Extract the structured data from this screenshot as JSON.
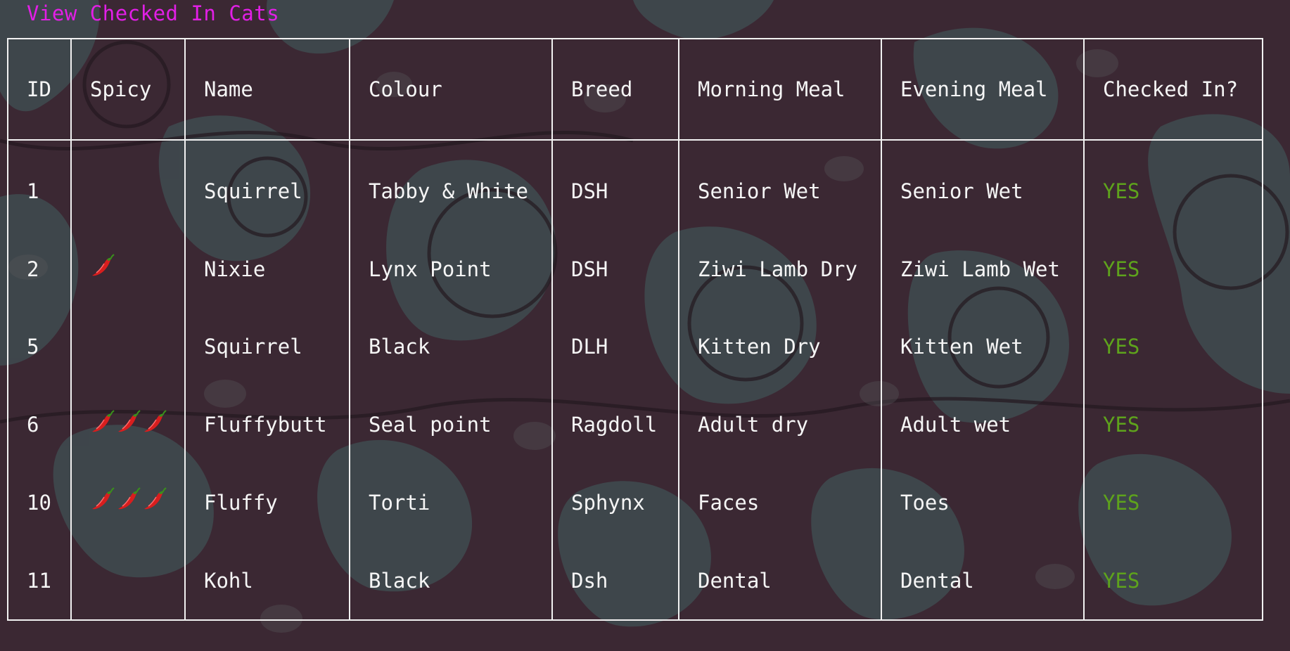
{
  "page": {
    "link_label": "View Checked In Cats"
  },
  "table": {
    "headers": [
      "ID",
      "Spicy",
      "Name",
      "Colour",
      "Breed",
      "Morning Meal",
      "Evening Meal",
      "Checked In?"
    ],
    "rows": [
      {
        "id": "1",
        "spicy": 0,
        "name": "Squirrel",
        "colour": "Tabby & White",
        "breed": "DSH",
        "morning": "Senior Wet",
        "evening": "Senior Wet",
        "checked": "YES"
      },
      {
        "id": "2",
        "spicy": 1,
        "name": "Nixie",
        "colour": "Lynx Point",
        "breed": "DSH",
        "morning": "Ziwi Lamb Dry",
        "evening": "Ziwi Lamb Wet",
        "checked": "YES"
      },
      {
        "id": "5",
        "spicy": 0,
        "name": "Squirrel",
        "colour": "Black",
        "breed": "DLH",
        "morning": "Kitten Dry",
        "evening": "Kitten Wet",
        "checked": "YES"
      },
      {
        "id": "6",
        "spicy": 3,
        "name": "Fluffybutt",
        "colour": "Seal point",
        "breed": "Ragdoll",
        "morning": "Adult dry",
        "evening": "Adult wet",
        "checked": "YES"
      },
      {
        "id": "10",
        "spicy": 3,
        "name": "Fluffy",
        "colour": "Torti",
        "breed": "Sphynx",
        "morning": "Faces",
        "evening": "Toes",
        "checked": "YES"
      },
      {
        "id": "11",
        "spicy": 0,
        "name": "Kohl",
        "colour": "Black",
        "breed": "Dsh",
        "morning": "Dental",
        "evening": "Dental",
        "checked": "YES"
      }
    ],
    "spicy_icon": "chilli-pepper-icon"
  },
  "colors": {
    "background": "#3b2833",
    "link": "#e21fe6",
    "text": "#f5f5f5",
    "border": "#f2f2f2",
    "checked_yes": "#5ea31c"
  }
}
